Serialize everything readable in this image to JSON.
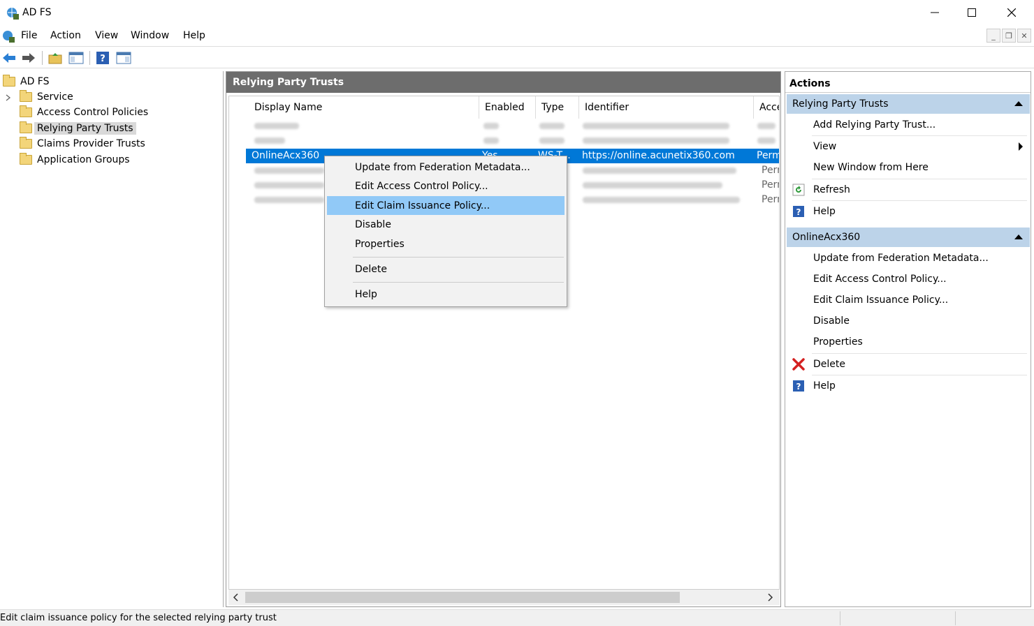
{
  "window": {
    "title": "AD FS"
  },
  "menu": [
    "File",
    "Action",
    "View",
    "Window",
    "Help"
  ],
  "tree": {
    "root": "AD FS",
    "items": [
      "Service",
      "Access Control Policies",
      "Relying Party Trusts",
      "Claims Provider Trusts",
      "Application Groups"
    ],
    "selected": "Relying Party Trusts"
  },
  "center": {
    "title": "Relying Party Trusts",
    "columns": [
      "Display Name",
      "Enabled",
      "Type",
      "Identifier",
      "Acce"
    ],
    "selected_row": {
      "display_name": "OnlineAcx360",
      "enabled": "Yes",
      "type": "WS-T...",
      "identifier": "https://online.acunetix360.com",
      "access": "Perm"
    },
    "other_rows_partial": [
      "Perm",
      "Perm",
      "Perm"
    ]
  },
  "context_menu": {
    "items": [
      "Update from Federation Metadata...",
      "Edit Access Control Policy...",
      "Edit Claim Issuance Policy...",
      "Disable",
      "Properties",
      "Delete",
      "Help"
    ],
    "highlighted": "Edit Claim Issuance Policy..."
  },
  "actions": {
    "title": "Actions",
    "section1": {
      "header": "Relying Party Trusts",
      "items": [
        "Add Relying Party Trust...",
        "View",
        "New Window from Here",
        "Refresh",
        "Help"
      ]
    },
    "section2": {
      "header": "OnlineAcx360",
      "items": [
        "Update from Federation Metadata...",
        "Edit Access Control Policy...",
        "Edit Claim Issuance Policy...",
        "Disable",
        "Properties",
        "Delete",
        "Help"
      ]
    }
  },
  "status": {
    "text": "Edit claim issuance policy for the selected relying party trust"
  },
  "colors": {
    "selection": "#0078d7",
    "menu_highlight": "#91c9f7",
    "section_header": "#bcd3e9",
    "pane_header": "#6d6d6d"
  }
}
